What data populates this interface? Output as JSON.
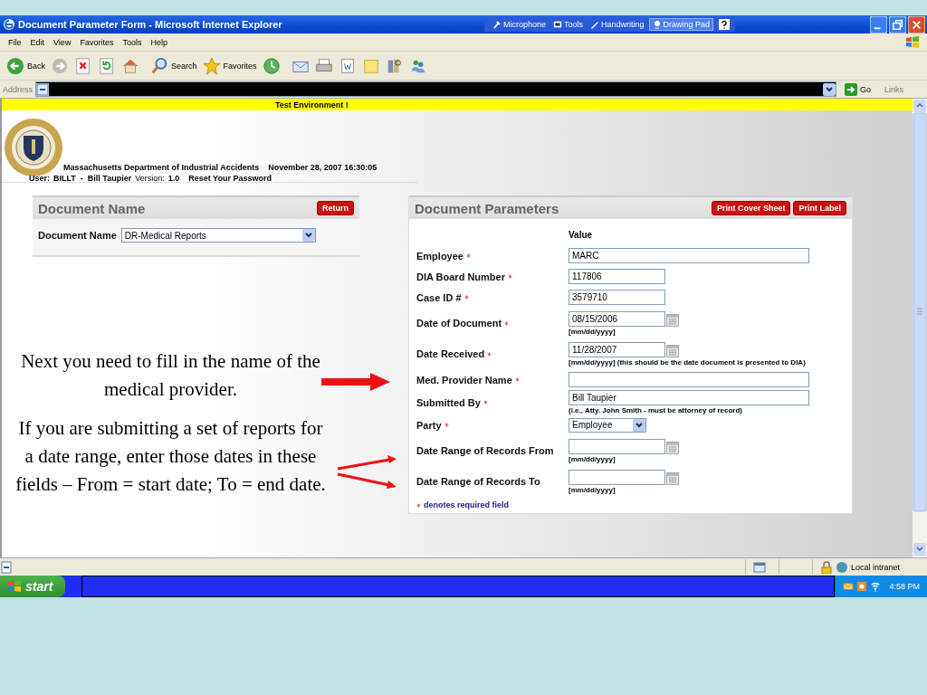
{
  "window": {
    "title": "Document Parameter Form - Microsoft Internet Explorer"
  },
  "language_bar": [
    {
      "kind": "microphone",
      "label": "Microphone"
    },
    {
      "kind": "tools",
      "label": "Tools"
    },
    {
      "kind": "handwriting",
      "label": "Handwriting"
    },
    {
      "kind": "drawing",
      "label": "Drawing Pad"
    }
  ],
  "menu": [
    "File",
    "Edit",
    "View",
    "Favorites",
    "Tools",
    "Help"
  ],
  "toolbar": [
    {
      "kind": "back",
      "label": "Back"
    },
    {
      "kind": "forward"
    },
    {
      "kind": "stop"
    },
    {
      "kind": "refresh"
    },
    {
      "kind": "home"
    },
    {
      "kind": "search",
      "label": "Search"
    },
    {
      "kind": "favorites",
      "label": "Favorites"
    },
    {
      "kind": "history"
    },
    {
      "kind": "mail"
    },
    {
      "kind": "print"
    },
    {
      "kind": "edit"
    },
    {
      "kind": "folder"
    },
    {
      "kind": "research"
    },
    {
      "kind": "messenger"
    }
  ],
  "address_bar": {
    "label": "Address",
    "go": "Go",
    "links": "Links"
  },
  "banner": "Test Environment !",
  "header": {
    "agency": "Massachusetts Department of Industrial Accidents",
    "datetime": "November 28, 2007 16:30:05",
    "user_label": "User:",
    "user": "BILLT  -  Bill Taupier",
    "version_label": "Version:",
    "version": "1.0",
    "reset_link": "Reset Your Password"
  },
  "document_name_panel": {
    "title": "Document Name",
    "button": "Return",
    "field_label": "Document Name",
    "value": "DR-Medical Reports"
  },
  "parameters_panel": {
    "title": "Document Parameters",
    "buttons": [
      "Print Cover Sheet",
      "Print Label"
    ],
    "column_header": "Value",
    "fields": [
      {
        "label": "Employee",
        "required": true,
        "kind": "text",
        "wide": true,
        "value": "MARC"
      },
      {
        "label": "DIA Board Number",
        "required": true,
        "kind": "text",
        "wide": false,
        "value": "117806"
      },
      {
        "label": "Case ID #",
        "required": true,
        "kind": "text",
        "wide": false,
        "value": "3579710"
      },
      {
        "label": "Date of Document",
        "required": true,
        "kind": "date",
        "value": "08/15/2006",
        "hint": "[mm/dd/yyyy]"
      },
      {
        "label": "Date Received",
        "required": true,
        "kind": "date",
        "value": "11/28/2007",
        "hint": "[mm/dd/yyyy] (this should be the date document is presented to DIA)"
      },
      {
        "label": "Med. Provider Name",
        "required": true,
        "kind": "text",
        "wide": true
      },
      {
        "label": "Submitted By",
        "required": true,
        "kind": "text",
        "wide": true,
        "value": "Bill Taupier",
        "hint": "(i.e., Atty. John Smith - must be attorney of record)"
      },
      {
        "label": "Party",
        "required": true,
        "kind": "select",
        "value": "Employee"
      },
      {
        "label": "Date Range of Records From",
        "required": false,
        "kind": "date",
        "hint": "[mm/dd/yyyy]"
      },
      {
        "label": "Date Range of Records To",
        "required": false,
        "kind": "date",
        "hint": "[mm/dd/yyyy]"
      }
    ],
    "footnote": "denotes required field"
  },
  "callouts": [
    "Next you need to fill in the name of the medical provider.",
    "If you are submitting a set of reports for a date range, enter those dates in these fields – From = start date; To = end date."
  ],
  "status_bar": {
    "zone": "Local intranet"
  },
  "taskbar": {
    "start": "start",
    "clock": "4:58 PM"
  }
}
